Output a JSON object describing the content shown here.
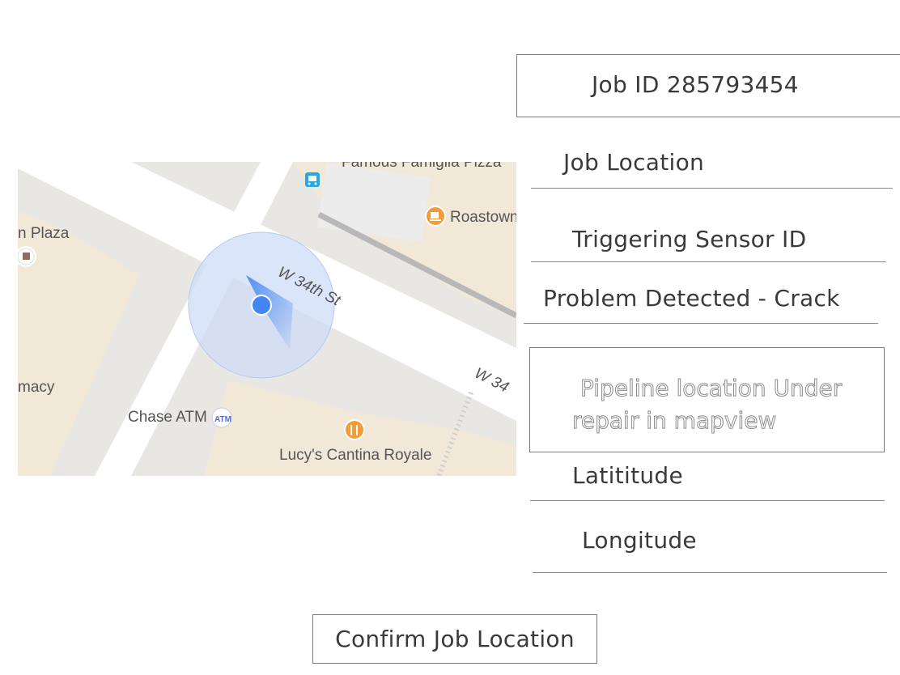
{
  "job": {
    "id_label": "Job ID 285793454"
  },
  "fields": {
    "job_location": "Job Location",
    "triggering_sensor": "Triggering Sensor ID",
    "problem": "Problem Detected - Crack",
    "pipeline_line1": "Pipeline location Under",
    "pipeline_line2": "repair in mapview",
    "latitude": "Latititude",
    "longitude": "Longitude"
  },
  "map": {
    "labels": {
      "top_place": "Famous Famiglia Pizza",
      "roastown": "Roastown",
      "plaza": "n Plaza",
      "street1": "W 34th St",
      "street2": "W 34",
      "pharmacy": "macy",
      "chase": "Chase ATM",
      "lucys": "Lucy's Cantina Royale",
      "atm_badge": "ATM"
    },
    "colors": {
      "block": "#f1e8d8",
      "road": "#ffffff",
      "ground": "#e9e7e3",
      "location_dot": "#4285f4"
    },
    "icons": [
      "bus-icon",
      "coffee-icon",
      "restaurant-icon",
      "atm-icon",
      "shop-icon"
    ]
  },
  "actions": {
    "confirm_label": "Confirm Job Location"
  }
}
